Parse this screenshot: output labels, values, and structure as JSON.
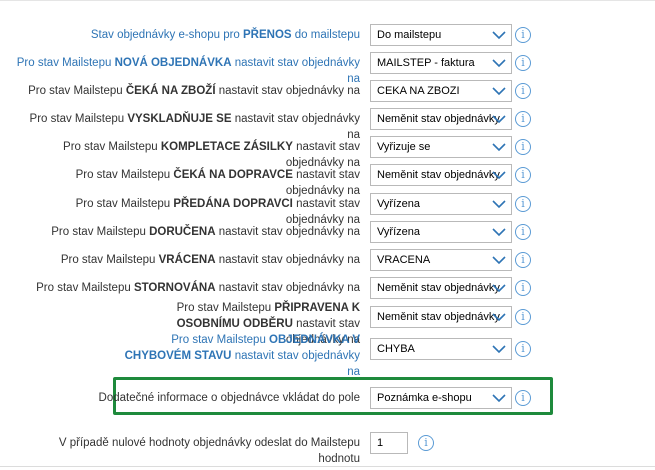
{
  "rows": [
    {
      "label_pre": "Stav objednávky e-shopu pro ",
      "label_bold": "PŘENOS",
      "label_post": " do mailstepu",
      "value": "Do mailstepu",
      "blue": true
    },
    {
      "label_pre": "Pro stav Mailstepu ",
      "label_bold": "NOVÁ OBJEDNÁVKA",
      "label_post": " nastavit stav objednávky na",
      "value": "MAILSTEP - faktura",
      "blue": true
    },
    {
      "label_pre": "Pro stav Mailstepu ",
      "label_bold": "ČEKÁ NA ZBOŽÍ",
      "label_post": " nastavit stav objednávky na",
      "value": "CEKA NA ZBOZI",
      "blue": false
    },
    {
      "label_pre": "Pro stav Mailstepu ",
      "label_bold": "VYSKLADŇUJE SE",
      "label_post": " nastavit stav objednávky na",
      "value": "Neměnit stav objednávky",
      "blue": false
    },
    {
      "label_pre": "Pro stav Mailstepu ",
      "label_bold": "KOMPLETACE ZÁSILKY",
      "label_post": " nastavit stav objednávky na",
      "value": "Vyřizuje se",
      "blue": false
    },
    {
      "label_pre": "Pro stav Mailstepu ",
      "label_bold": "ČEKÁ NA DOPRAVCE",
      "label_post": " nastavit stav objednávky na",
      "value": "Neměnit stav objednávky",
      "blue": false
    },
    {
      "label_pre": "Pro stav Mailstepu ",
      "label_bold": "PŘEDÁNA DOPRAVCI",
      "label_post": " nastavit stav objednávky na",
      "value": "Vyřízena",
      "blue": false
    },
    {
      "label_pre": "Pro stav Mailstepu ",
      "label_bold": "DORUČENA",
      "label_post": " nastavit stav objednávky na",
      "value": "Vyřízena",
      "blue": false
    },
    {
      "label_pre": "Pro stav Mailstepu ",
      "label_bold": "VRÁCENA",
      "label_post": " nastavit stav objednávky na",
      "value": "VRACENA",
      "blue": false
    },
    {
      "label_pre": "Pro stav Mailstepu ",
      "label_bold": "STORNOVÁNA",
      "label_post": " nastavit stav objednávky na",
      "value": "Neměnit stav objednávky",
      "blue": false
    },
    {
      "label_pre": "Pro stav Mailstepu ",
      "label_bold": "PŘIPRAVENA K OSOBNÍMU ODBĚRU",
      "label_post": " nastavit stav objednávky na",
      "value": "Neměnit stav objednávky",
      "blue": false
    },
    {
      "label_pre": "Pro stav Mailstepu ",
      "label_bold": "OBJEDNÁVKA V CHYBOVÉM STAVU",
      "label_post": " nastavit stav objednávky na",
      "value": "CHYBA",
      "blue": true
    }
  ],
  "extra_info": {
    "label": "Dodatečné informace o objednávce vkládat do pole",
    "value": "Poznámka e-shopu"
  },
  "zero_value": {
    "label": "V případě nulové hodnoty objednávky odeslat do Mailstepu hodnotu",
    "value": "1"
  },
  "info_glyph": "i",
  "colors": {
    "label_blue": "#2e74b5",
    "highlight": "#1e8a3c",
    "chevron": "#2e74b5",
    "info": "#5b9bd5"
  }
}
